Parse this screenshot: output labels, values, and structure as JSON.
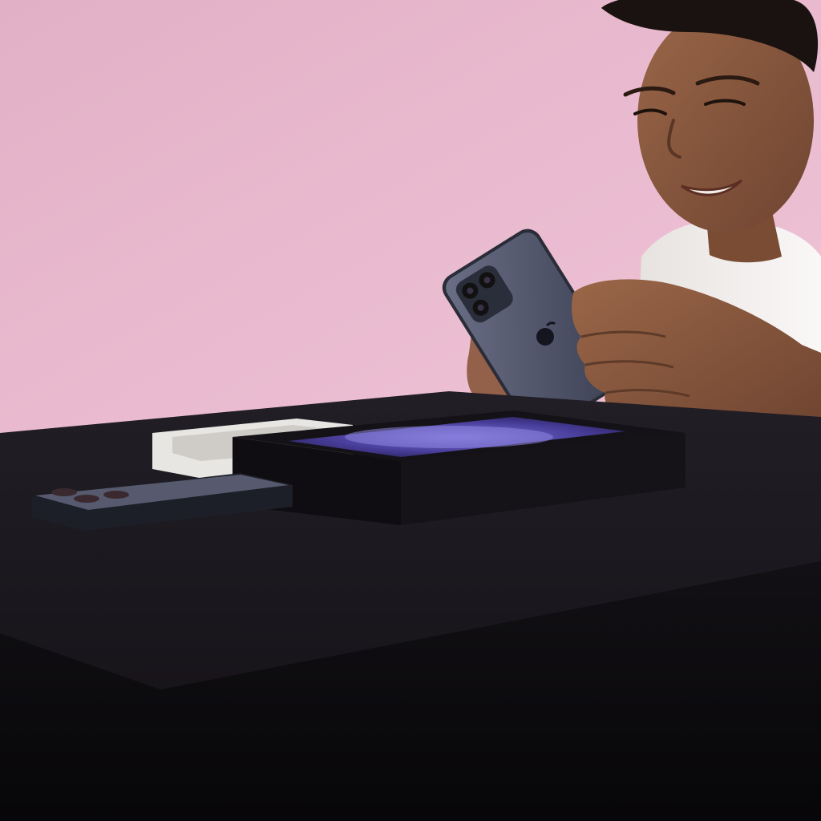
{
  "scene": {
    "description_tags": [
      "person",
      "smartphone",
      "phone-box",
      "table",
      "pink-backdrop"
    ]
  },
  "colors": {
    "backdrop": "#e8b6cc",
    "table_top": "#1c1820",
    "table_front": "#0c0a0e",
    "phone_body": "#4a4e63",
    "screen_glow": "#4b3f9e",
    "shirt": "#f2f0ee",
    "skin": "#8a5a3e"
  }
}
